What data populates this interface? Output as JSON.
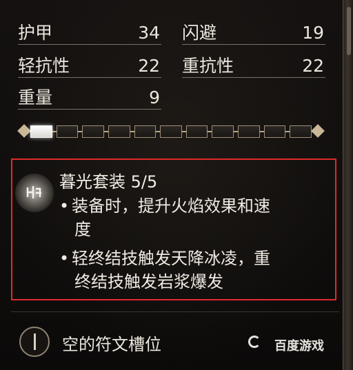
{
  "stats": [
    {
      "label": "护甲",
      "value": "34"
    },
    {
      "label": "闪避",
      "value": "19"
    },
    {
      "label": "轻抗性",
      "value": "22"
    },
    {
      "label": "重抗性",
      "value": "22"
    },
    {
      "label": "重量",
      "value": "9"
    }
  ],
  "gauge": {
    "filled_slots": 1,
    "total_slots": 11
  },
  "set_bonus": {
    "title": "暮光套装 5/5",
    "bullet_symbol": "•",
    "bullets": [
      {
        "line1": "装备时，提升火焰效果和速",
        "line2": "度"
      },
      {
        "line1": "轻终结技触发天降冰凌，重",
        "line2": "终结技触发岩浆爆发"
      }
    ],
    "icon": "rune-glyph-icon"
  },
  "rune_slot": {
    "label": "空的符文槽位",
    "icon": "rune-slot-icon"
  },
  "watermark": "百度游戏",
  "colors": {
    "highlight_border": "#e02a2a",
    "text": "#ece7de",
    "background": "#100e0d"
  }
}
